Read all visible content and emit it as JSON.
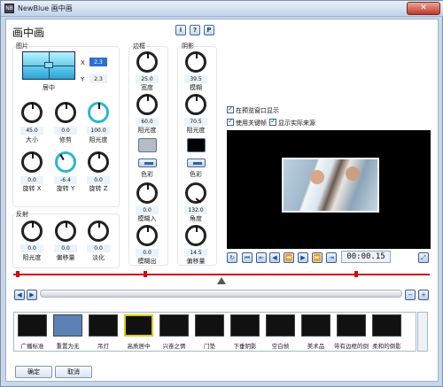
{
  "window": {
    "title": "NewBlue 画中画",
    "app_icon": "NB",
    "close": "✕"
  },
  "header": {
    "title": "画中画",
    "info": "i",
    "help": "?",
    "presets": "P"
  },
  "image_group": {
    "label": "图片",
    "x_label": "X",
    "x_value": "2.3",
    "y_label": "Y",
    "y_value": "2.3",
    "position_label": "居中",
    "knobs": [
      {
        "value": "45.0",
        "label": "大小"
      },
      {
        "value": "0.0",
        "label": "修剪"
      },
      {
        "value": "100.0",
        "label": "阻光度"
      },
      {
        "value": "0.0",
        "label": "旋转 X"
      },
      {
        "value": "-6.4",
        "label": "旋转 Y"
      },
      {
        "value": "0.0",
        "label": "旋转 Z"
      }
    ]
  },
  "reflection_group": {
    "label": "反射",
    "knobs": [
      {
        "value": "0.0",
        "label": "阻光度"
      },
      {
        "value": "0.0",
        "label": "偏移量"
      },
      {
        "value": "0.0",
        "label": "淡化"
      }
    ]
  },
  "border_group": {
    "label": "边框",
    "knobs": [
      {
        "value": "25.0",
        "label": "宽度"
      },
      {
        "value": "60.0",
        "label": "阻光度"
      },
      {
        "value": "0.0",
        "label": "模糊入"
      },
      {
        "value": "0.0",
        "label": "模糊出"
      }
    ],
    "color_label": "色彩",
    "swatch_color": "#b8bcc2"
  },
  "shadow_group": {
    "label": "阴影",
    "knobs": [
      {
        "value": "39.5",
        "label": "模糊"
      },
      {
        "value": "70.5",
        "label": "阻光度"
      },
      {
        "value": "132.0",
        "label": "角度"
      },
      {
        "value": "14.5",
        "label": "偏移量"
      }
    ],
    "color_label": "色彩",
    "swatch_color": "#000000"
  },
  "options": {
    "preview_window": "在预览窗口显示",
    "use_keyframes": "使用关键帧",
    "show_actual_source": "显示实际来源"
  },
  "transport": {
    "time": "00:00.15"
  },
  "presets": [
    "广播标准",
    "重置为无",
    "吊灯",
    "高质居中",
    "兴奋之情",
    "门垫",
    "下垂阴影",
    "空白帧",
    "美术品",
    "带有边框的倒影",
    "柔和的倒影"
  ],
  "footer": {
    "ok": "确定",
    "cancel": "取消"
  },
  "colors": {
    "accent": "#2ab7d4",
    "keyframe": "#c81010"
  }
}
